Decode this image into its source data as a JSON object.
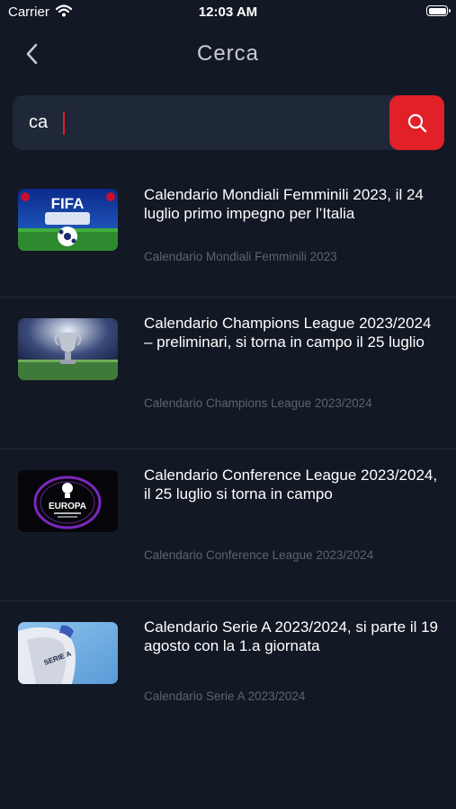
{
  "status_bar": {
    "carrier": "Carrier",
    "time": "12:03 AM"
  },
  "nav": {
    "title": "Cerca",
    "back_icon": "chevron-left-icon"
  },
  "search": {
    "value": "ca",
    "button_icon": "search-icon"
  },
  "colors": {
    "background": "#121824",
    "search_field": "#1e2838",
    "accent": "#e12028",
    "subtitle": "#5c6473"
  },
  "results": [
    {
      "title": "Calendario Mondiali Femminili 2023, il 24 luglio primo impegno per l’Italia",
      "subtitle": "Calendario Mondiali Femminili 2023",
      "thumbnail": "fifa-womens-world-cup",
      "thumb_text": "FIFA"
    },
    {
      "title": "Calendario Champions League 2023/2024 – preliminari, si torna in campo il 25 luglio",
      "subtitle": "Calendario Champions League 2023/2024",
      "thumbnail": "champions-league-trophy"
    },
    {
      "title": "Calendario Conference League 2023/2024, il 25 luglio si torna in campo",
      "subtitle": "Calendario Conference League 2023/2024",
      "thumbnail": "conference-league-logo",
      "thumb_text": "EUROPA"
    },
    {
      "title": "Calendario Serie A 2023/2024, si parte il 19 agosto con la 1.a giornata",
      "subtitle": "Calendario Serie A 2023/2024",
      "thumbnail": "serie-a-flag",
      "thumb_text": "SERIE A"
    }
  ]
}
